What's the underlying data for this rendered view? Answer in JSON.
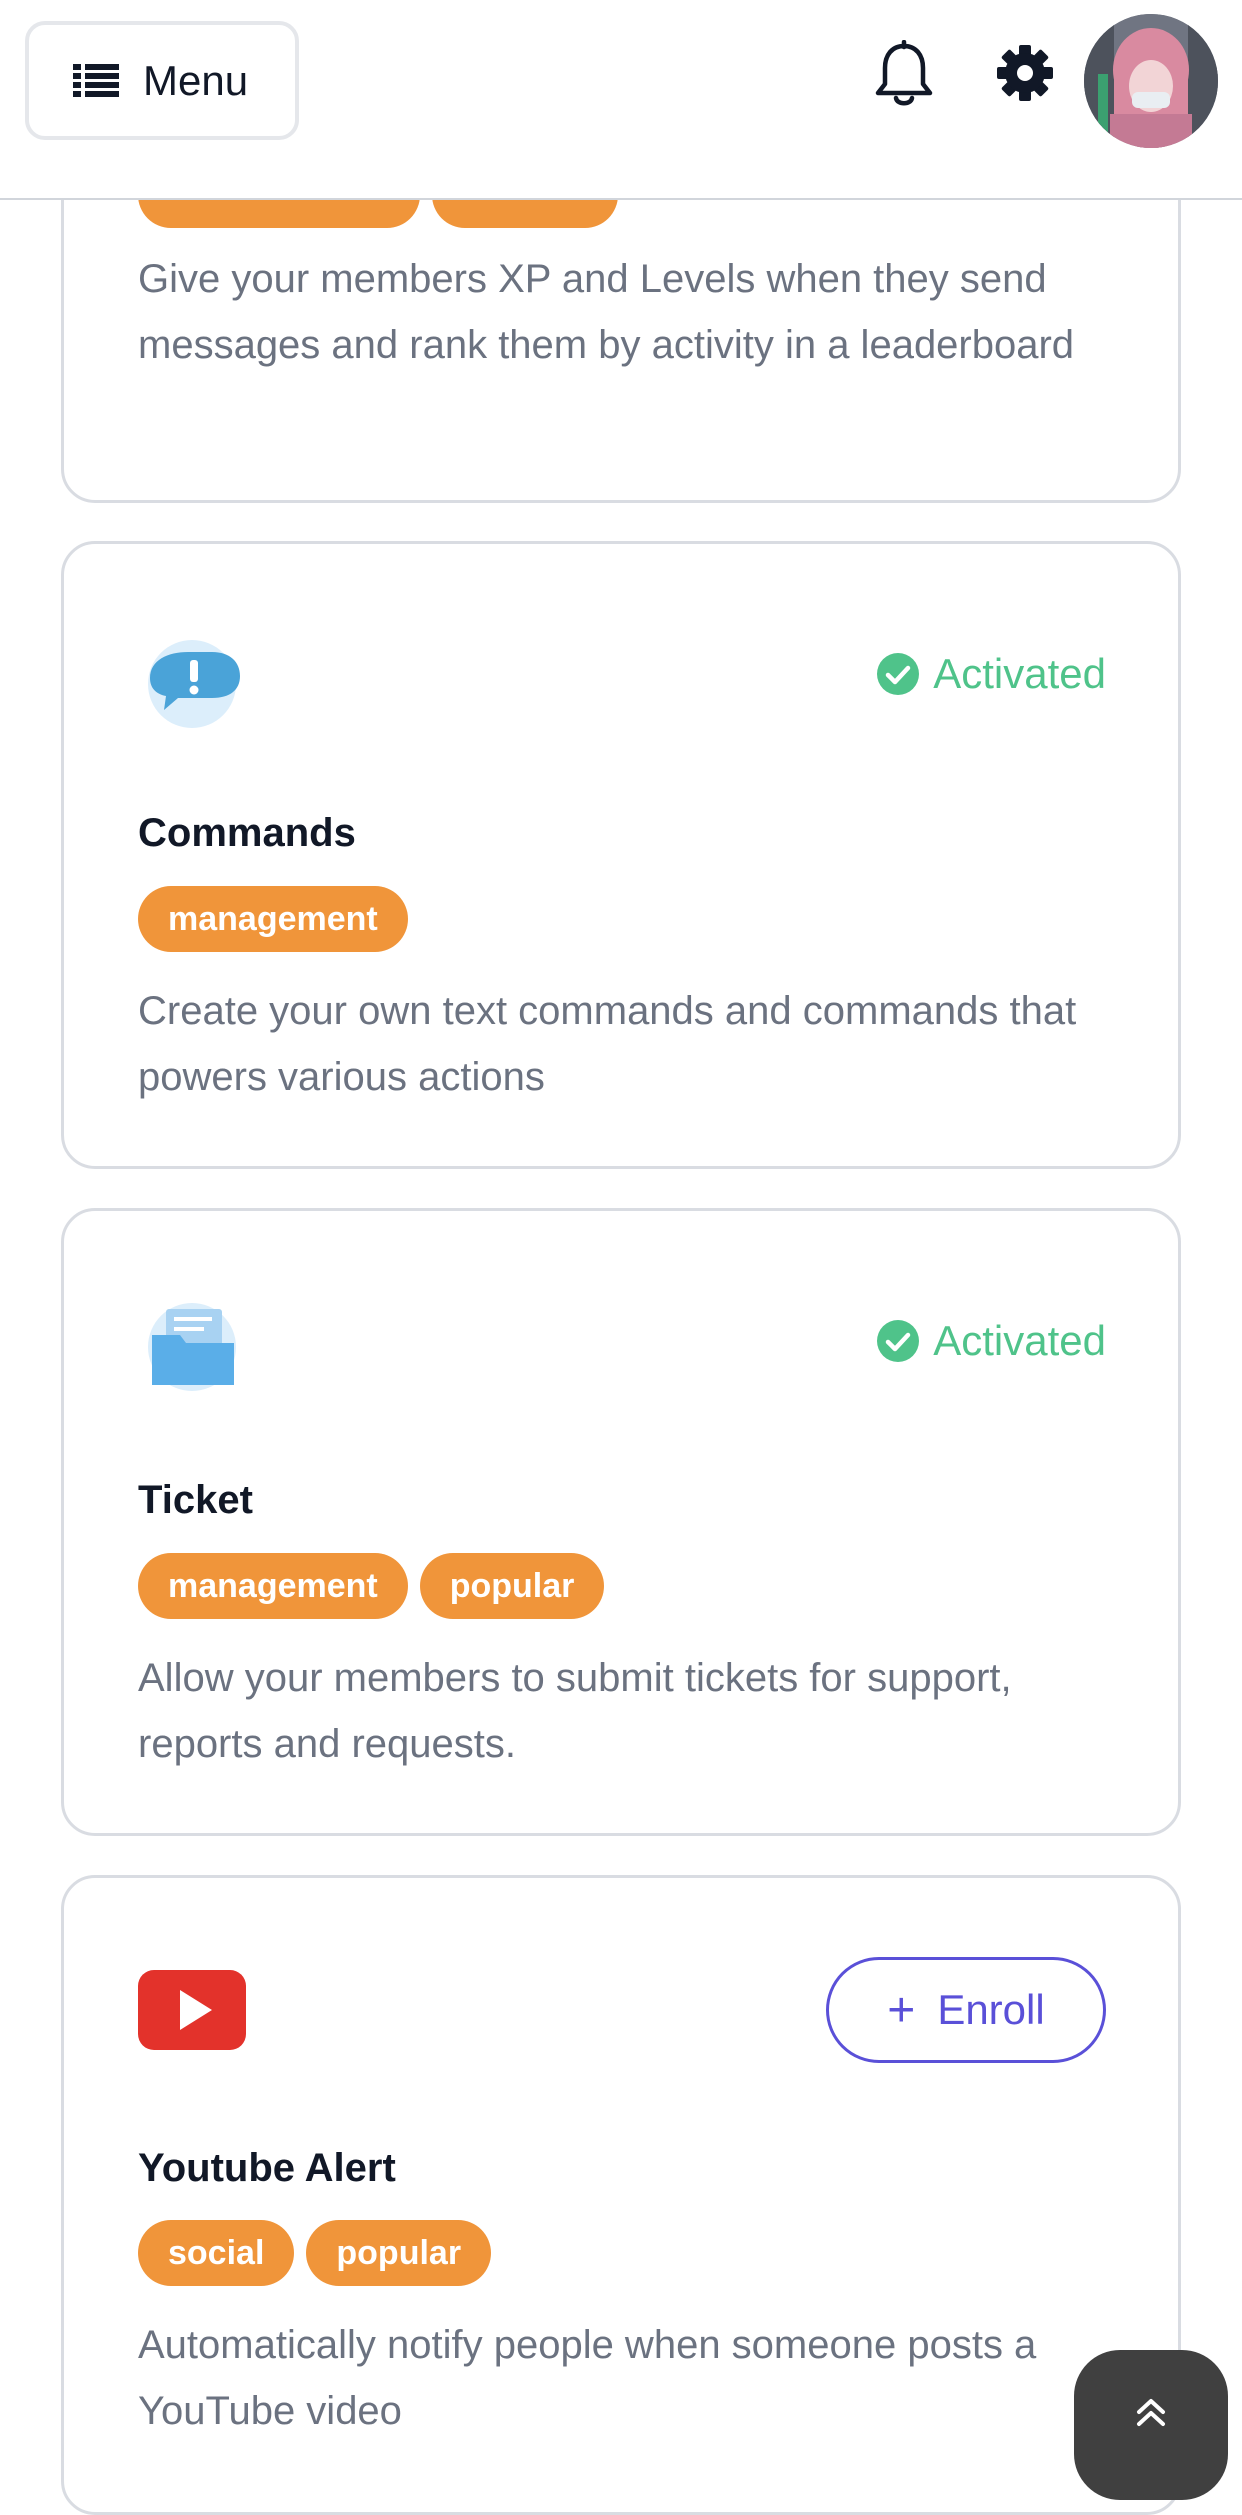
{
  "header": {
    "menu_label": "Menu",
    "icons": [
      "list-icon",
      "bell-icon",
      "gear-icon",
      "avatar"
    ]
  },
  "colors": {
    "tag": "#f0953a",
    "activated": "#4fc38a",
    "enroll": "#5a50d8",
    "text_muted": "#6b7280"
  },
  "cards": [
    {
      "title": "",
      "tags": [],
      "description": "Give your members XP and Levels when they send messages and rank them by activity in a leaderboard",
      "status": ""
    },
    {
      "title": "Commands",
      "icon": "exclamation-chat-icon",
      "status": "Activated",
      "tags": [
        "management"
      ],
      "description": "Create your own text commands and commands that powers various actions"
    },
    {
      "title": "Ticket",
      "icon": "folder-icon",
      "status": "Activated",
      "tags": [
        "management",
        "popular"
      ],
      "description": "Allow your members to submit tickets for support, reports and requests."
    },
    {
      "title": "Youtube Alert",
      "icon": "youtube-icon",
      "action": "Enroll",
      "tags": [
        "social",
        "popular"
      ],
      "description": "Automatically notify people when someone posts a YouTube video"
    }
  ],
  "scroll_top_icon": "double-chevron-up-icon"
}
